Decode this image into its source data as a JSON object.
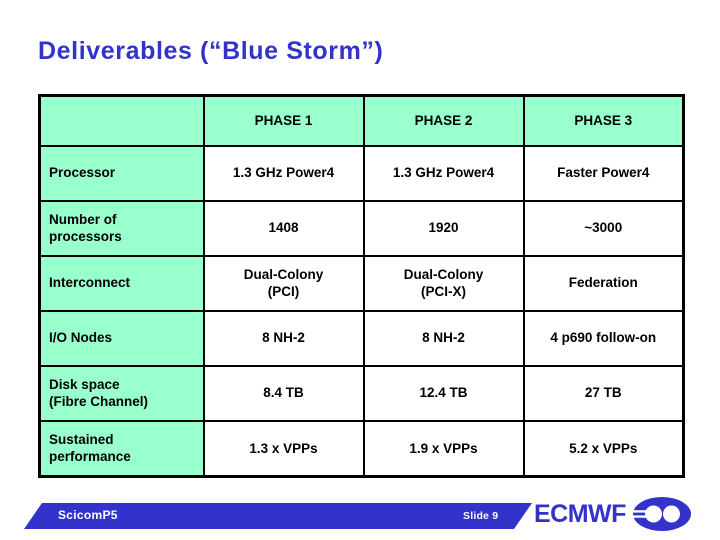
{
  "slide": {
    "title": "Deliverables (“Blue Storm”)",
    "title_color": "#3333cc",
    "background_color": "#ffffff"
  },
  "table": {
    "header_bg": "#99ffcc",
    "label_col_bg": "#99ffcc",
    "data_cell_bg": "#ffffff",
    "border_color": "#000000",
    "columns": [
      "",
      "PHASE 1",
      "PHASE 2",
      "PHASE 3"
    ],
    "rows": [
      {
        "label": "Processor",
        "label_lines": [
          "Processor"
        ],
        "values": [
          "1.3 GHz Power4",
          "1.3 GHz Power4",
          "Faster Power4"
        ]
      },
      {
        "label": "Number of processors",
        "label_lines": [
          "Number of",
          "processors"
        ],
        "values": [
          "1408",
          "1920",
          "~3000"
        ]
      },
      {
        "label": "Interconnect",
        "label_lines": [
          "Interconnect"
        ],
        "values": [
          "Dual-Colony (PCI)",
          "Dual-Colony (PCI-X)",
          "Federation"
        ],
        "value_lines": [
          [
            "Dual-Colony",
            "(PCI)"
          ],
          [
            "Dual-Colony",
            "(PCI-X)"
          ],
          [
            "Federation"
          ]
        ]
      },
      {
        "label": "I/O Nodes",
        "label_lines": [
          "I/O Nodes"
        ],
        "values": [
          "8 NH-2",
          "8 NH-2",
          "4 p690 follow-on"
        ]
      },
      {
        "label": "Disk space (Fibre Channel)",
        "label_lines": [
          "Disk space",
          "(Fibre Channel)"
        ],
        "values": [
          "8.4  TB",
          "12.4 TB",
          "27 TB"
        ]
      },
      {
        "label": "Sustained performance",
        "label_lines": [
          "Sustained",
          "performance"
        ],
        "values": [
          "1.3 x VPPs",
          "1.9 x VPPs",
          "5.2 x VPPs"
        ]
      }
    ]
  },
  "footer": {
    "banner_color": "#3333cc",
    "presentation_name": "ScicomP5",
    "slide_number": "Slide 9",
    "brand_name": "ECMWF",
    "brand_color": "#3333cc",
    "logo_icon": "ecmwf-logo-icon"
  }
}
